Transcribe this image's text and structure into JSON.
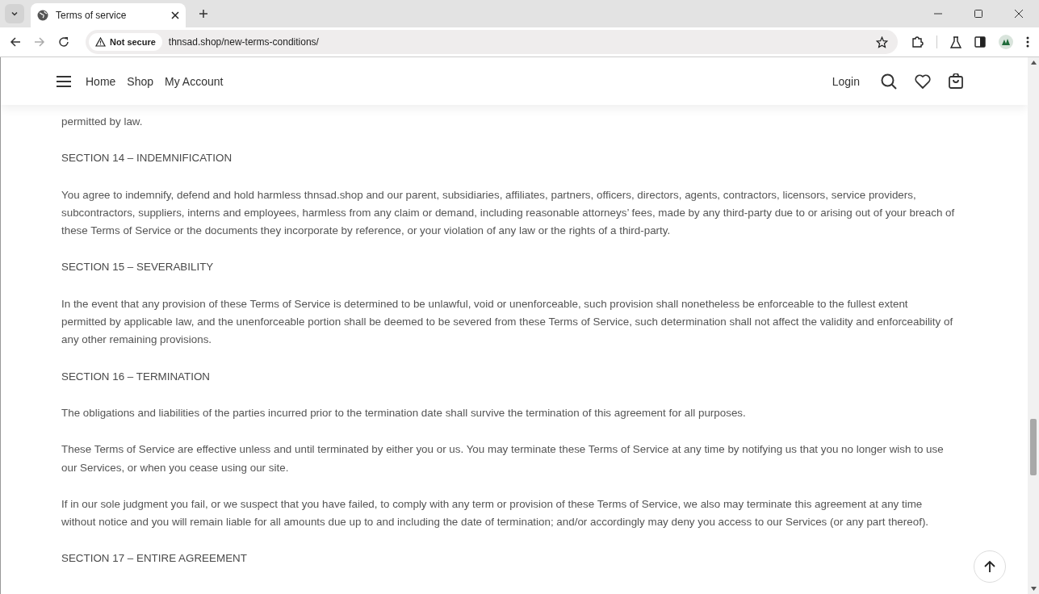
{
  "browser": {
    "tab": {
      "title": "Terms of service",
      "selected": true
    },
    "security": "Not secure",
    "url": "thnsad.shop/new-terms-conditions/"
  },
  "nav": {
    "links": [
      "Home",
      "Shop",
      "My Account"
    ],
    "login": "Login"
  },
  "content": [
    {
      "kind": "paragraph",
      "text": "permitted by law."
    },
    {
      "kind": "heading",
      "text": "SECTION 14 – INDEMNIFICATION"
    },
    {
      "kind": "paragraph",
      "text": "You agree to indemnify, defend and hold harmless thnsad.shop and our parent, subsidiaries, affiliates, partners, officers, directors, agents, contractors, licensors, service providers, subcontractors, suppliers, interns and employees, harmless from any claim or demand, including reasonable attorneys’ fees, made by any third-party due to or arising out of your breach of these Terms of Service or the documents they incorporate by reference, or your violation of any law or the rights of a third-party."
    },
    {
      "kind": "heading",
      "text": "SECTION 15 – SEVERABILITY"
    },
    {
      "kind": "paragraph",
      "text": "In the event that any provision of these Terms of Service is determined to be unlawful, void or unenforceable, such provision shall nonetheless be enforceable to the fullest extent permitted by applicable law, and the unenforceable portion shall be deemed to be severed from these Terms of Service, such determination shall not affect the validity and enforceability of any other remaining provisions."
    },
    {
      "kind": "heading",
      "text": "SECTION 16 – TERMINATION"
    },
    {
      "kind": "paragraph",
      "text": "The obligations and liabilities of the parties incurred prior to the termination date shall survive the termination of this agreement for all purposes."
    },
    {
      "kind": "paragraph",
      "text": "These Terms of Service are effective unless and until terminated by either you or us. You may terminate these Terms of Service at any time by notifying us that you no longer wish to use our Services, or when you cease using our site."
    },
    {
      "kind": "paragraph",
      "text": "If in our sole judgment you fail, or we suspect that you have failed, to comply with any term or provision of these Terms of Service, we also may terminate this agreement at any time without notice and you will remain liable for all amounts due up to and including the date of termination; and/or accordingly may deny you access to our Services (or any part thereof)."
    },
    {
      "kind": "heading",
      "text": "SECTION 17 – ENTIRE AGREEMENT"
    }
  ]
}
